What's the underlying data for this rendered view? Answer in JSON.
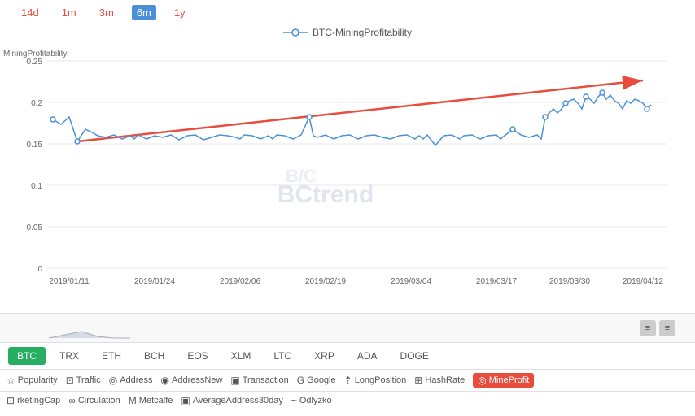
{
  "timeRange": {
    "options": [
      "14d",
      "1m",
      "3m",
      "6m",
      "1y"
    ],
    "active": "6m"
  },
  "chartTitle": "BTC-MiningProfitability",
  "yAxis": {
    "title": "MiningProfitability",
    "labels": [
      "0.25",
      "0.2",
      "0.15",
      "0.1",
      "0.05",
      "0"
    ]
  },
  "xAxis": {
    "labels": [
      "2019/01/11",
      "2019/01/24",
      "2019/02/06",
      "2019/02/19",
      "2019/03/04",
      "2019/03/17",
      "2019/03/30",
      "2019/04/12"
    ]
  },
  "watermark": "BCtrend",
  "coins": {
    "tabs": [
      "BTC",
      "TRX",
      "ETH",
      "BCH",
      "EOS",
      "XLM",
      "LTC",
      "XRP",
      "ADA",
      "DOGE"
    ],
    "active": "BTC"
  },
  "metrics": {
    "row1": [
      {
        "icon": "★",
        "label": "Popularity"
      },
      {
        "icon": "◫",
        "label": "Traffic"
      },
      {
        "icon": "◯",
        "label": "Address"
      },
      {
        "icon": "◉",
        "label": "AddressNew"
      },
      {
        "icon": "◨",
        "label": "Transaction"
      },
      {
        "icon": "G",
        "label": "Google"
      },
      {
        "icon": "⇡",
        "label": "LongPosition"
      },
      {
        "icon": "⊞",
        "label": "HashRate"
      },
      {
        "icon": "◎",
        "label": "MineProfit",
        "active": true
      }
    ],
    "row2": [
      {
        "icon": "◫",
        "label": "rketingCap"
      },
      {
        "icon": "∞",
        "label": "Circulation"
      },
      {
        "icon": "M",
        "label": "Metcalfe"
      },
      {
        "icon": "◨",
        "label": "AverageAddress30day"
      },
      {
        "icon": "~",
        "label": "Odlyzko"
      }
    ]
  },
  "miniChart": {
    "controls": [
      "≡",
      "≡"
    ]
  }
}
